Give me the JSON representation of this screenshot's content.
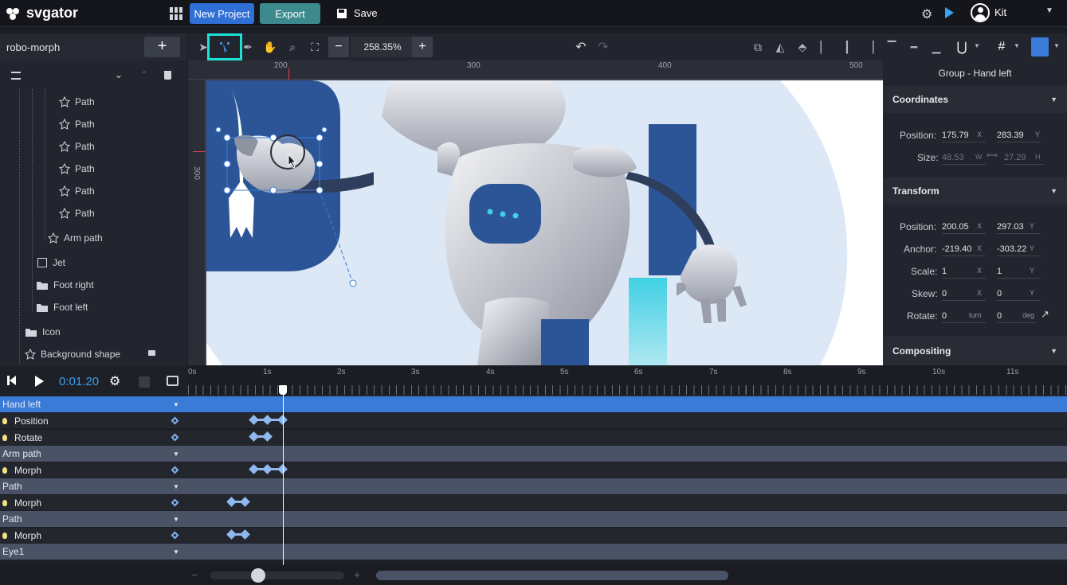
{
  "topbar": {
    "logo": "svgator",
    "new_project": "New Project",
    "export": "Export",
    "save": "Save",
    "user": "Kit"
  },
  "left": {
    "project_name": "robo-morph",
    "layers": [
      "Path",
      "Path",
      "Path",
      "Path",
      "Path",
      "Path",
      "Arm path",
      "Jet",
      "Foot right",
      "Foot left",
      "Icon",
      "Background shape"
    ]
  },
  "toolbar": {
    "zoom": "258.35%"
  },
  "ruler": {
    "marks": [
      "200",
      "300",
      "400",
      "500"
    ],
    "vmark": "300"
  },
  "right": {
    "title": "Group - Hand left",
    "coordinates": {
      "heading": "Coordinates",
      "position_label": "Position:",
      "pos_x": "175.79",
      "pos_y": "283.39",
      "size_label": "Size:",
      "size_w": "48.53",
      "size_h": "27.29"
    },
    "transform": {
      "heading": "Transform",
      "position_label": "Position:",
      "pos_x": "200.05",
      "pos_y": "297.03",
      "anchor_label": "Anchor:",
      "anchor_x": "-219.40",
      "anchor_y": "-303.22",
      "scale_label": "Scale:",
      "scale_x": "1",
      "scale_y": "1",
      "skew_label": "Skew:",
      "skew_x": "0",
      "skew_y": "0",
      "rotate_label": "Rotate:",
      "rotate_turn": "0",
      "turn_unit": "turn",
      "rotate_deg": "0",
      "deg_unit": "deg"
    },
    "compositing": "Compositing",
    "axis_x": "X",
    "axis_y": "Y",
    "axis_w": "W",
    "axis_h": "H"
  },
  "timeline": {
    "time": "0:01.20",
    "ticks": [
      "0s",
      "1s",
      "2s",
      "3s",
      "4s",
      "5s",
      "6s",
      "7s",
      "8s",
      "9s",
      "10s",
      "11s"
    ],
    "rows": [
      {
        "type": "group",
        "label": "Hand left",
        "selected": true
      },
      {
        "type": "prop",
        "label": "Position"
      },
      {
        "type": "prop",
        "label": "Rotate"
      },
      {
        "type": "group",
        "label": "Arm path"
      },
      {
        "type": "prop",
        "label": "Morph"
      },
      {
        "type": "group",
        "label": "Path"
      },
      {
        "type": "prop",
        "label": "Morph"
      },
      {
        "type": "group",
        "label": "Path"
      },
      {
        "type": "prop",
        "label": "Morph"
      },
      {
        "type": "group",
        "label": "Eye1"
      }
    ]
  },
  "colors": {
    "accent": "#2f6fd6",
    "export": "#3d8a8e",
    "selected": "#3b7bd8",
    "highlight": "#1ee0d4"
  }
}
